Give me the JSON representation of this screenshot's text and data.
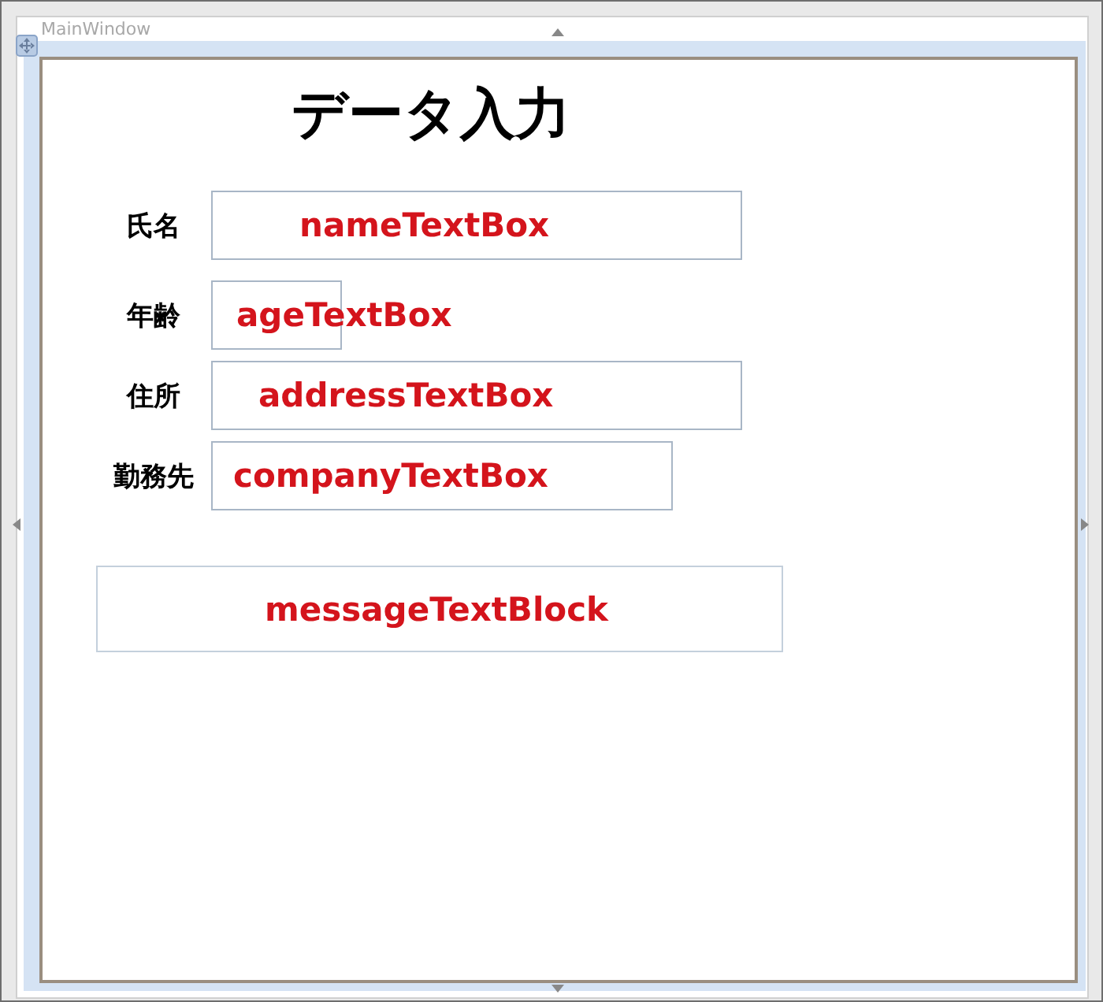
{
  "window": {
    "title": "MainWindow"
  },
  "heading": "データ入力",
  "fields": [
    {
      "label": "氏名",
      "control_name": "nameTextBox"
    },
    {
      "label": "年齢",
      "control_name": "ageTextBox"
    },
    {
      "label": "住所",
      "control_name": "addressTextBox"
    },
    {
      "label": "勤務先",
      "control_name": "companyTextBox"
    }
  ],
  "message_block": {
    "control_name": "messageTextBlock"
  }
}
